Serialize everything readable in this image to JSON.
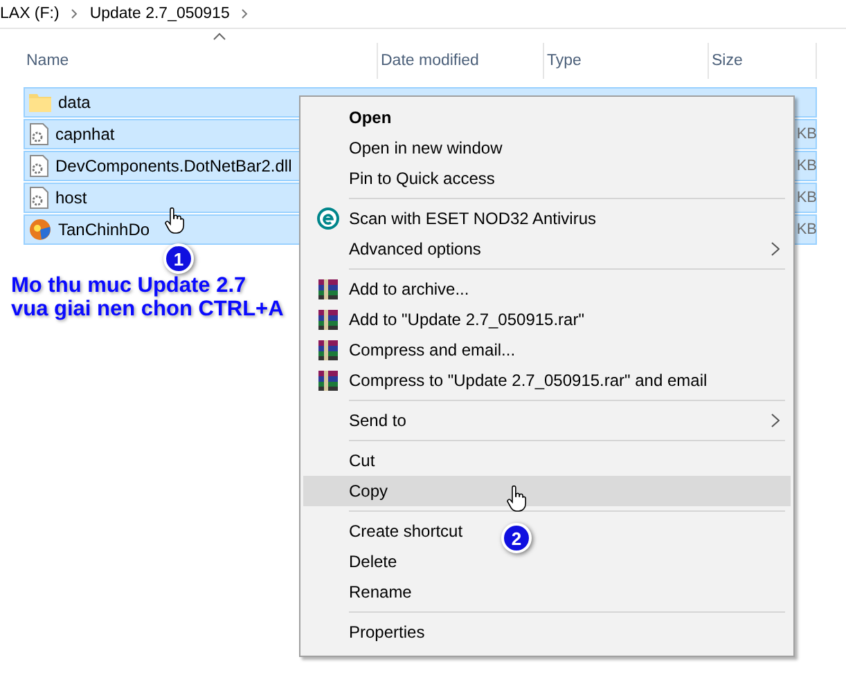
{
  "breadcrumb": [
    {
      "label": "LAX (F:)"
    },
    {
      "label": "Update 2.7_050915"
    }
  ],
  "columns": [
    {
      "label": "Name",
      "sorted": true
    },
    {
      "label": "Date modified"
    },
    {
      "label": "Type"
    },
    {
      "label": "Size"
    }
  ],
  "files": [
    {
      "name": "data",
      "kind": "folder",
      "selected": true
    },
    {
      "name": "capnhat",
      "kind": "file",
      "size": "KB",
      "selected": true
    },
    {
      "name": "DevComponents.DotNetBar2.dll",
      "kind": "file",
      "size": "KB",
      "selected": true
    },
    {
      "name": "host",
      "kind": "file",
      "size": "KB",
      "selected": true
    },
    {
      "name": "TanChinhDo",
      "kind": "app",
      "size": "KB",
      "selected": true
    }
  ],
  "context_menu": [
    {
      "kind": "item",
      "label": "Open",
      "bold": true
    },
    {
      "kind": "item",
      "label": "Open in new window"
    },
    {
      "kind": "item",
      "label": "Pin to Quick access"
    },
    {
      "kind": "separator"
    },
    {
      "kind": "eset",
      "label": "Scan with ESET NOD32 Antivirus"
    },
    {
      "kind": "item",
      "label": "Advanced options",
      "submenu": true
    },
    {
      "kind": "separator"
    },
    {
      "kind": "rar",
      "label": "Add to archive..."
    },
    {
      "kind": "rar",
      "label": "Add to \"Update 2.7_050915.rar\""
    },
    {
      "kind": "rar",
      "label": "Compress and email..."
    },
    {
      "kind": "rar",
      "label": "Compress to \"Update 2.7_050915.rar\" and email"
    },
    {
      "kind": "separator"
    },
    {
      "kind": "item",
      "label": "Send to",
      "submenu": true
    },
    {
      "kind": "separator"
    },
    {
      "kind": "item",
      "label": "Cut"
    },
    {
      "kind": "item",
      "label": "Copy",
      "selected": true
    },
    {
      "kind": "separator"
    },
    {
      "kind": "item",
      "label": "Create shortcut"
    },
    {
      "kind": "item",
      "label": "Delete"
    },
    {
      "kind": "item",
      "label": "Rename"
    },
    {
      "kind": "separator"
    },
    {
      "kind": "item",
      "label": "Properties"
    }
  ],
  "annotations": {
    "steps": [
      {
        "number": "1"
      },
      {
        "number": "2"
      }
    ],
    "note": [
      "Mo thu muc Update 2.7",
      "vua giai nen chon CTRL+A"
    ]
  }
}
